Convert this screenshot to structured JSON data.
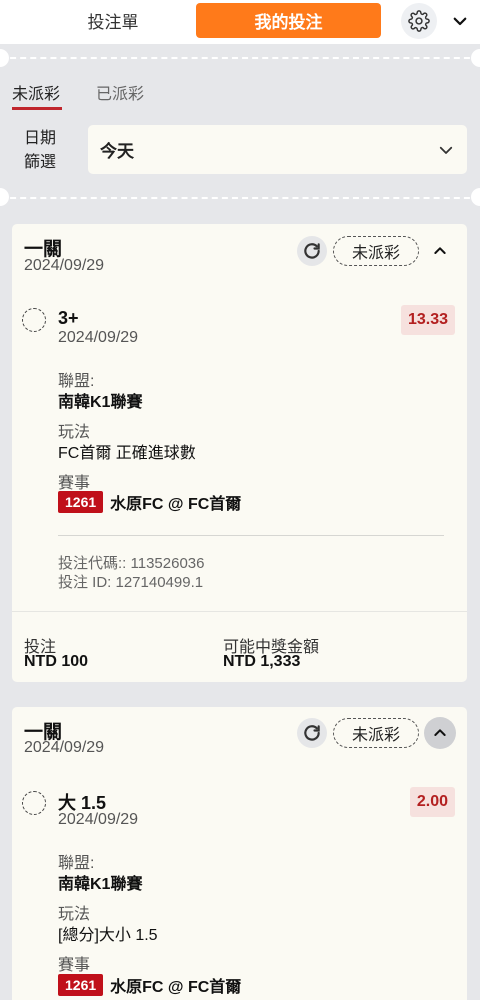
{
  "header": {
    "tab_betslip": "投注單",
    "tab_mybets": "我的投注"
  },
  "status_tabs": {
    "unsettled": "未派彩",
    "settled": "已派彩"
  },
  "filter": {
    "label_line1": "日期",
    "label_line2": "篩選",
    "selected": "今天"
  },
  "bets": [
    {
      "title": "一關",
      "date": "2024/09/29",
      "status": "未派彩",
      "selection": "3+",
      "selection_date": "2024/09/29",
      "odds": "13.33",
      "league_label": "聯盟:",
      "league": "南韓K1聯賽",
      "market_label": "玩法",
      "market": "FC首爾 正確進球數",
      "event_label": "賽事",
      "event_id": "1261",
      "event_name": "水原FC @ FC首爾",
      "bet_code": "投注代碼:: 113526036",
      "bet_id": "投注 ID: 127140499.1",
      "stake_label": "投注",
      "stake": "NTD 100",
      "payout_label": "可能中獎金額",
      "payout": "NTD 1,333"
    },
    {
      "title": "一關",
      "date": "2024/09/29",
      "status": "未派彩",
      "selection": "大 1.5",
      "selection_date": "2024/09/29",
      "odds": "2.00",
      "league_label": "聯盟:",
      "league": "南韓K1聯賽",
      "market_label": "玩法",
      "market": "[總分]大小 1.5",
      "event_label": "賽事",
      "event_id": "1261",
      "event_name": "水原FC @ FC首爾"
    }
  ],
  "colors": {
    "accent": "#ff7a1a",
    "tab_underline": "#c0262d",
    "odds_text": "#b32020",
    "event_badge": "#c0101a",
    "background": "#e6e7ea",
    "card": "#fbfaf3"
  }
}
